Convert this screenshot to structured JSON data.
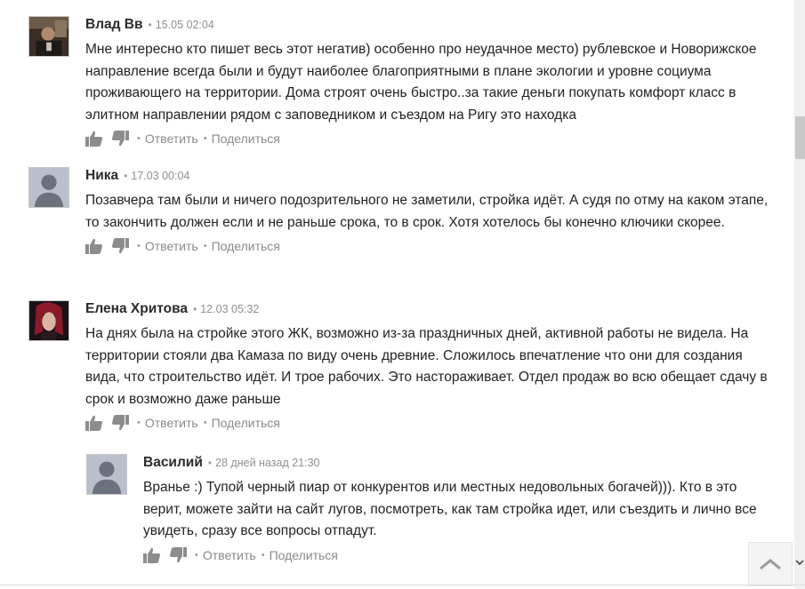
{
  "comments": [
    {
      "author": "Влад Вв",
      "time": "15.05 02:04",
      "avatar": "photo-man-dark",
      "text": "Мне интересно кто пишет весь этот негатив) особенно про неудачное место) рублевское и Новорижское направление всегда были и будут наиболее благоприятными в плане экологии и уровне социума проживающего на территории. Дома строят очень быстро..за такие деньги покупать комфорт класс в элитном направлении рядом с заповедником и съездом на Ригу это находка"
    },
    {
      "author": "Ника",
      "time": "17.03 00:04",
      "avatar": "default-avatar",
      "text": "Позавчера там были и ничего подозрительного не заметили, стройка идёт. А судя по отму на каком этапе, то закончить должен если и не раньше срока, то в срок. Хотя хотелось бы конечно ключики скорее."
    },
    {
      "author": "Елена Хритова",
      "time": "12.03 05:32",
      "avatar": "photo-woman-red",
      "text": "На днях была на стройке этого ЖК, возможно из-за праздничных дней, активной работы не видела. На территории стояли два Камаза по виду очень древние. Сложилось впечатление что они для создания вида, что строительство идёт. И трое рабочих. Это настораживает. Отдел продаж во всю обещает сдачу в срок и возможно даже раньше"
    },
    {
      "author": "Василий",
      "time": "28 дней назад 21:30",
      "avatar": "default-avatar",
      "text": "Вранье :)  Тупой черный пиар от конкурентов или местных недовольных богачей))). Кто в это верит, можете зайти на сайт лугов, посмотреть, как там стройка идет, или съездить и лично все увидеть, сразу все вопросы отпадут."
    }
  ],
  "actions": {
    "reply_label": "Ответить",
    "share_label": "Поделиться",
    "separator": "•"
  },
  "icons": {
    "like": "thumbs-up-icon",
    "dislike": "thumbs-down-icon",
    "scroll_top": "chevron-up-icon"
  },
  "colors": {
    "author": "#2b2b2b",
    "text": "#222222",
    "meta": "#8f8f8f",
    "icon": "#8c8c8c"
  }
}
